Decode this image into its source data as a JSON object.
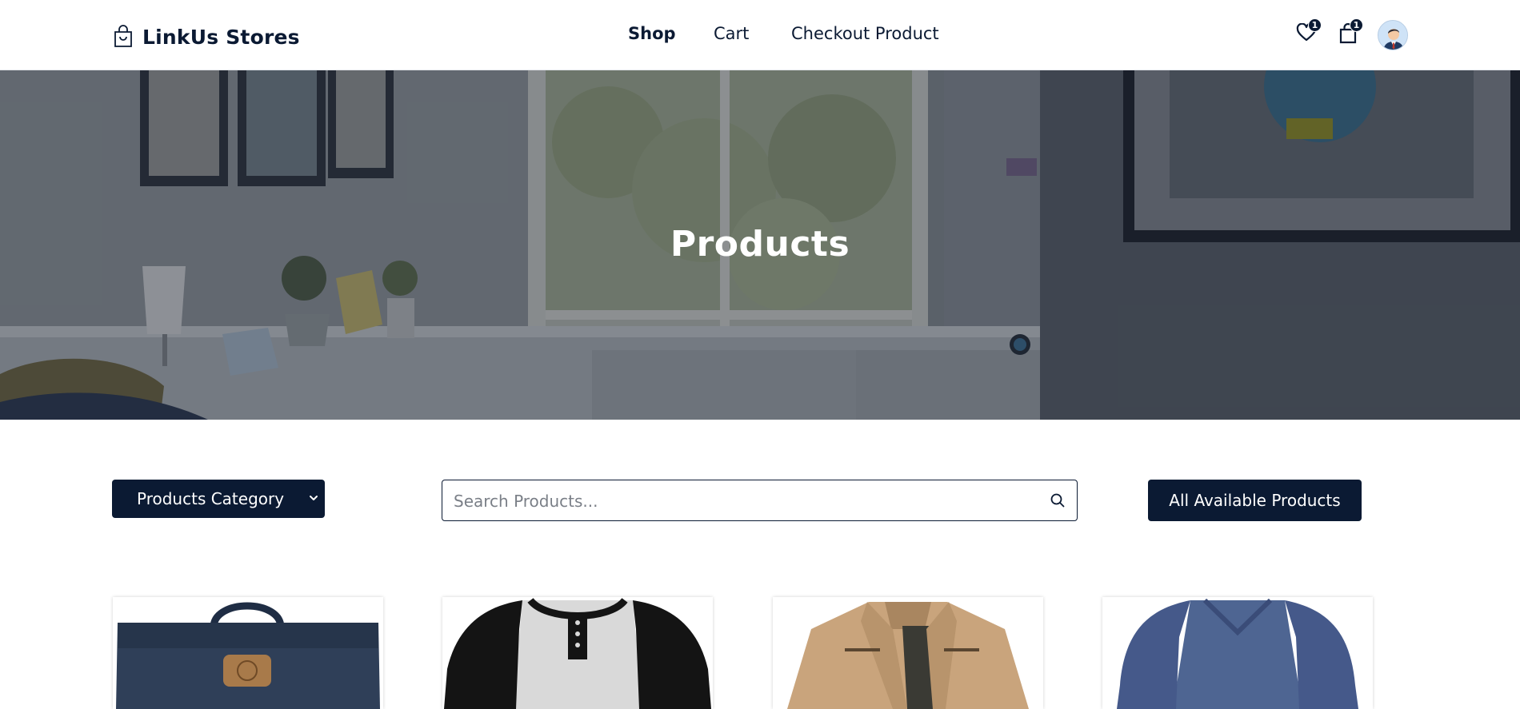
{
  "brand": {
    "name": "LinkUs Stores",
    "icon": "shopping-bag-icon"
  },
  "nav": {
    "shop": "Shop",
    "cart": "Cart",
    "checkout": "Checkout Product"
  },
  "header_icons": {
    "wishlist": {
      "icon": "heart-icon",
      "count": "1"
    },
    "cart": {
      "icon": "shopping-bag-icon",
      "count": "1"
    },
    "avatar": {
      "icon": "user-avatar-icon"
    }
  },
  "hero": {
    "title": "Products"
  },
  "filters": {
    "category_label": "Products Category",
    "search_placeholder": "Search Products...",
    "search_icon": "search-icon",
    "all_products_label": "All Available Products"
  },
  "products": [
    {
      "image": "navy-backpack"
    },
    {
      "image": "raglan-henley-shirt"
    },
    {
      "image": "khaki-jacket"
    },
    {
      "image": "blue-vneck-longsleeve"
    }
  ],
  "colors": {
    "primary": "#0b1a33",
    "hero_text": "#ffffff",
    "background": "#ffffff"
  }
}
